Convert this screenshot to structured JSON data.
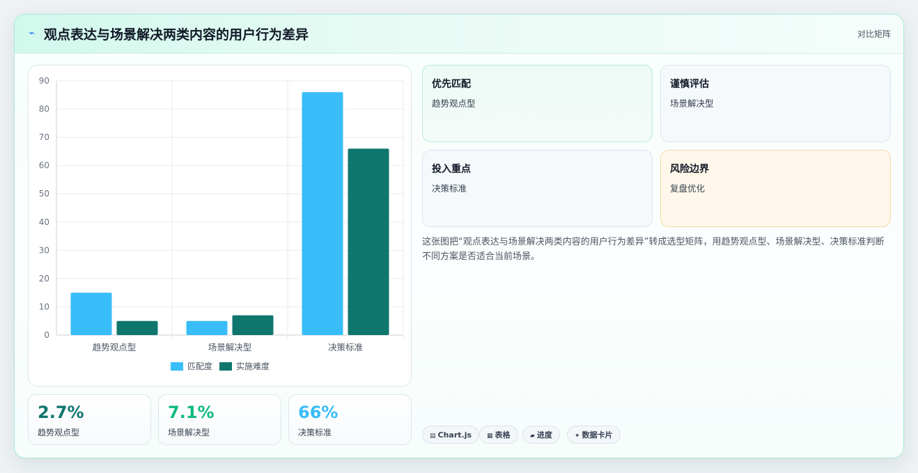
{
  "header": {
    "icon": "lightning-icon",
    "title": "观点表达与场景解决两类内容的用户行为差异",
    "badge": "对比矩阵"
  },
  "chart_data": {
    "type": "bar",
    "categories": [
      "趋势观点型",
      "场景解决型",
      "决策标准"
    ],
    "series": [
      {
        "name": "匹配度",
        "color": "#38bdf8",
        "values": [
          15,
          5,
          86
        ]
      },
      {
        "name": "实施难度",
        "color": "#0f766e",
        "values": [
          5,
          7,
          66
        ]
      }
    ],
    "ylim": [
      0,
      90
    ],
    "yticks": [
      0,
      10,
      20,
      30,
      40,
      50,
      60,
      70,
      80,
      90
    ],
    "grid": true,
    "legend": "bottom"
  },
  "stats": [
    {
      "value": "2.7%",
      "label": "趋势观点型",
      "color": "#0f766e"
    },
    {
      "value": "7.1%",
      "label": "场景解决型",
      "color": "#10b981"
    },
    {
      "value": "66%",
      "label": "决策标准",
      "color": "#38bdf8"
    }
  ],
  "matrix": [
    {
      "title": "优先匹配",
      "value": "趋势观点型"
    },
    {
      "title": "谨慎评估",
      "value": "场景解决型"
    },
    {
      "title": "投入重点",
      "value": "决策标准"
    },
    {
      "title": "风险边界",
      "value": "复盘优化"
    }
  ],
  "description": "这张图把“观点表达与场景解决两类内容的用户行为差异”转成选型矩阵，用趋势观点型、场景解决型、决策标准判断不同方案是否适合当前场景。",
  "tags": [
    {
      "icon": "chart-icon",
      "label": "Chart.js"
    },
    {
      "icon": "table-icon",
      "label": "表格"
    },
    {
      "icon": "progress-icon",
      "label": "进度"
    },
    {
      "icon": "sparkle-icon",
      "label": "数据卡片"
    }
  ]
}
